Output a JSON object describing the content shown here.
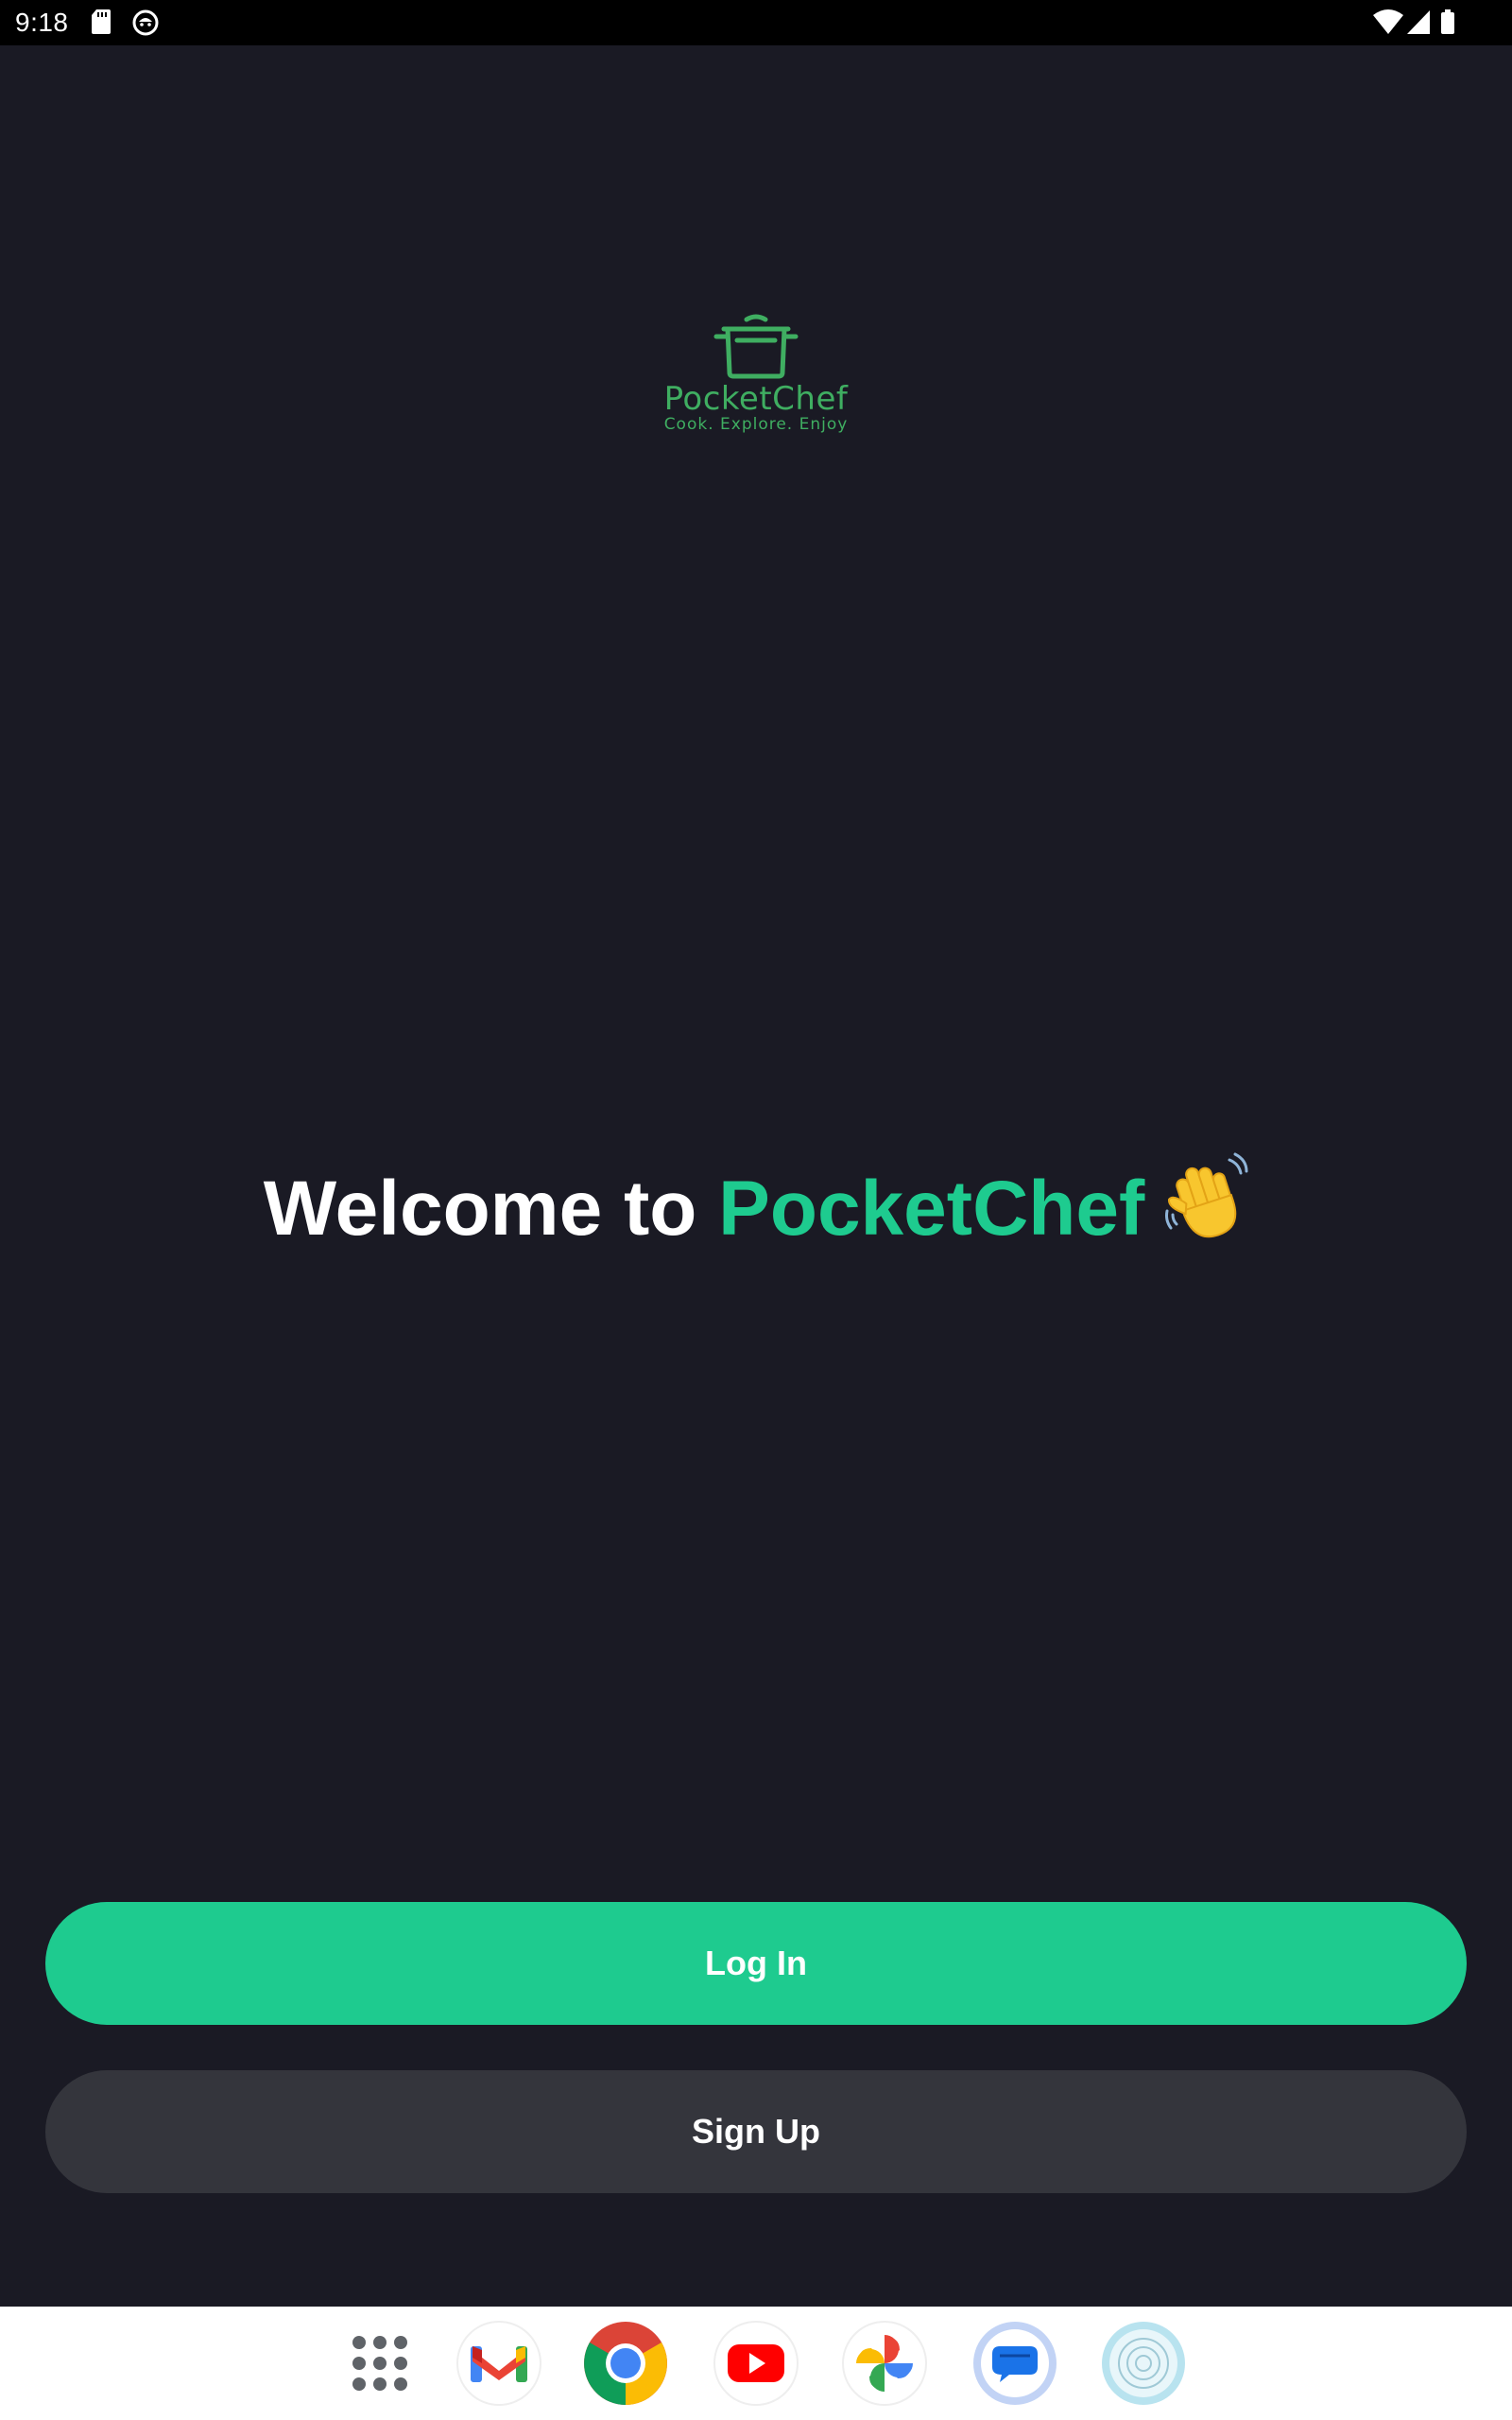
{
  "status_bar": {
    "time": "9:18",
    "icons": [
      "sd-card-icon",
      "cat-face-icon",
      "wifi-icon",
      "signal-icon",
      "battery-icon"
    ]
  },
  "logo": {
    "name": "PocketChef",
    "tagline": "Cook. Explore. Enjoy",
    "icon": "cooking-pot-icon",
    "color": "#3fae61"
  },
  "welcome": {
    "prefix": "Welcome to ",
    "brand": "PocketChef",
    "emoji_icon": "waving-hand-icon"
  },
  "buttons": {
    "login_label": "Log In",
    "signup_label": "Sign Up"
  },
  "dock": {
    "apps": [
      {
        "name": "App drawer",
        "icon": "app-drawer-icon"
      },
      {
        "name": "Gmail",
        "icon": "gmail-icon"
      },
      {
        "name": "Chrome",
        "icon": "chrome-icon"
      },
      {
        "name": "YouTube",
        "icon": "youtube-icon"
      },
      {
        "name": "Photos",
        "icon": "photos-icon"
      },
      {
        "name": "Messages",
        "icon": "messages-icon"
      },
      {
        "name": "Camera",
        "icon": "camera-icon"
      }
    ]
  },
  "colors": {
    "background": "#1a1a24",
    "accent": "#1ecb8f",
    "secondary_button": "#34353c",
    "status_bar": "#000000",
    "dock": "#ffffff"
  }
}
